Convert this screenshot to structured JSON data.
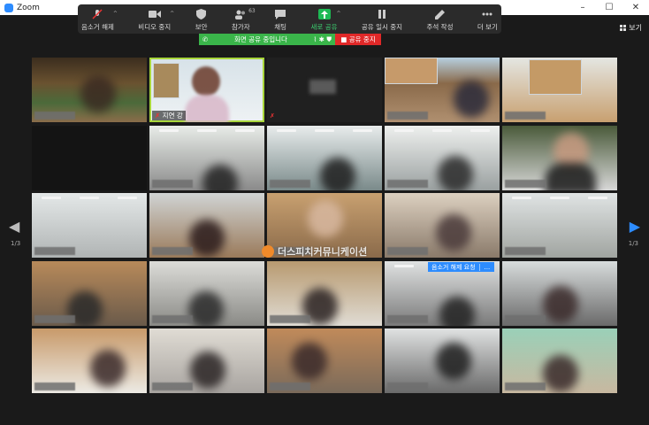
{
  "window": {
    "title": "Zoom"
  },
  "toolbar": {
    "unmute": "음소거 해제",
    "video_stop": "비디오 중지",
    "security": "보안",
    "participants": "참가자",
    "participants_count": "63",
    "chat": "채팅",
    "new_share": "새로 공유",
    "pause_share": "공유 일시 중지",
    "annotate": "주석 작성",
    "more": "더 보기"
  },
  "share_bar": {
    "sharing_text": "화면 공유 중입니다",
    "stop_label": "공유 중지"
  },
  "view_button": {
    "label": "보기"
  },
  "active_speaker": {
    "name": "지연 강"
  },
  "unmute_request": {
    "label": "음소거 해제 요청",
    "more": "..."
  },
  "watermark": {
    "text": "더스피치커뮤니케이션"
  },
  "pagination": {
    "left": "1/3",
    "right": "1/3"
  },
  "colors": {
    "accent": "#2d8cff",
    "share_green": "#3ab54a",
    "stop_red": "#e02828",
    "active_border": "#a8d63a"
  }
}
